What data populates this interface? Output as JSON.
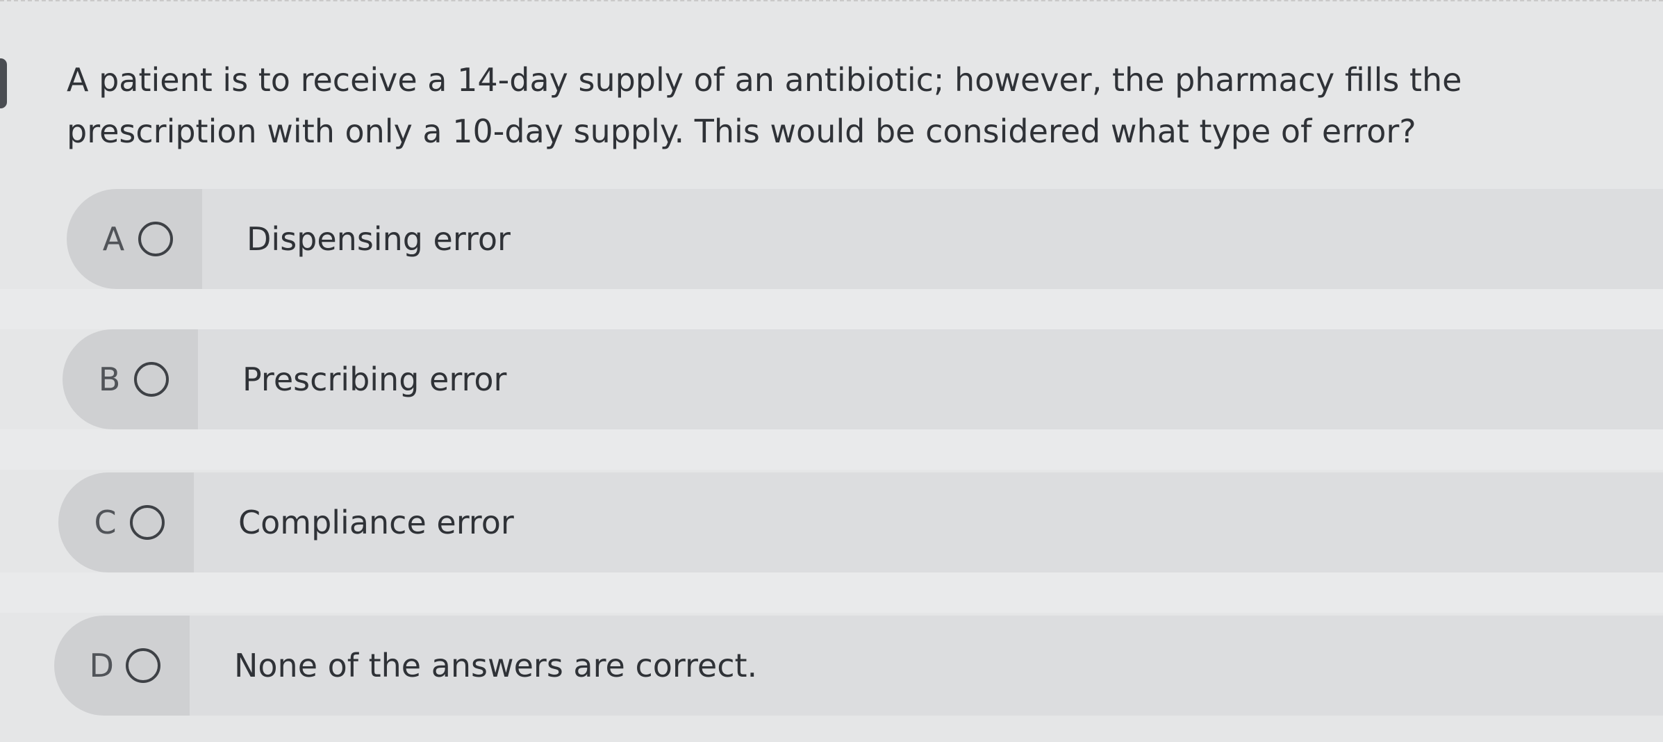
{
  "question": {
    "text": "A patient is to receive a 14-day supply of an antibiotic; however, the pharmacy fills the prescription with only a 10-day supply. This would be considered what type of error?"
  },
  "options": [
    {
      "letter": "A",
      "label": "Dispensing error",
      "selected": false
    },
    {
      "letter": "B",
      "label": "Prescribing error",
      "selected": false
    },
    {
      "letter": "C",
      "label": "Compliance error",
      "selected": false
    },
    {
      "letter": "D",
      "label": "None of the answers are correct.",
      "selected": false
    }
  ],
  "colors": {
    "background": "#e5e6e7",
    "option_letter_panel": "#cfd0d2",
    "option_answer_panel": "#dcdddf",
    "text": "#2f3237"
  }
}
